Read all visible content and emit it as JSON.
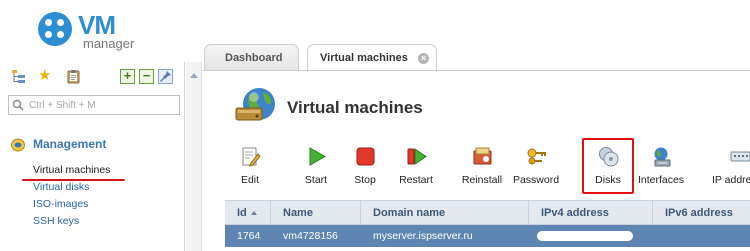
{
  "header": {
    "logo_main": "VM",
    "logo_sub": "manager"
  },
  "sidebar": {
    "search": {
      "placeholder": "Ctrl + Shift + M"
    },
    "group": {
      "label": "Management"
    },
    "items": [
      {
        "label": "Virtual machines",
        "active": true
      },
      {
        "label": "Virtual disks",
        "active": false
      },
      {
        "label": "ISO-images",
        "active": false
      },
      {
        "label": "SSH keys",
        "active": false
      }
    ],
    "toolbar_icons": [
      "tree-icon",
      "star-icon",
      "clipboard-icon",
      "expand-plus-icon",
      "collapse-minus-icon",
      "pin-icon"
    ]
  },
  "tabs": [
    {
      "label": "Dashboard",
      "active": false
    },
    {
      "label": "Virtual machines",
      "active": true
    }
  ],
  "page": {
    "title": "Virtual machines"
  },
  "toolbar": {
    "buttons": [
      {
        "label": "Edit",
        "icon": "edit-icon"
      },
      {
        "label": "Start",
        "icon": "start-icon"
      },
      {
        "label": "Stop",
        "icon": "stop-icon"
      },
      {
        "label": "Restart",
        "icon": "restart-icon"
      },
      {
        "label": "Reinstall",
        "icon": "reinstall-icon"
      },
      {
        "label": "Password",
        "icon": "key-icon"
      },
      {
        "label": "Disks",
        "icon": "disks-icon",
        "highlighted": true
      },
      {
        "label": "Interfaces",
        "icon": "interfaces-icon"
      },
      {
        "label": "IP addre",
        "icon": "ip-address-icon"
      }
    ]
  },
  "table": {
    "columns": [
      "Id",
      "Name",
      "Domain name",
      "IPv4 address",
      "IPv6 address"
    ],
    "sort_column": "Id",
    "rows": [
      {
        "id": "1764",
        "name": "vm4728156",
        "domain": "myserver.ispserver.ru",
        "ipv4": "",
        "ipv6": ""
      }
    ]
  },
  "colors": {
    "brand": "#2e8ed3",
    "link": "#2a66a4",
    "highlight": "#e01010",
    "selected_row": "#5f86b3",
    "table_header": "#e4e9f0"
  }
}
